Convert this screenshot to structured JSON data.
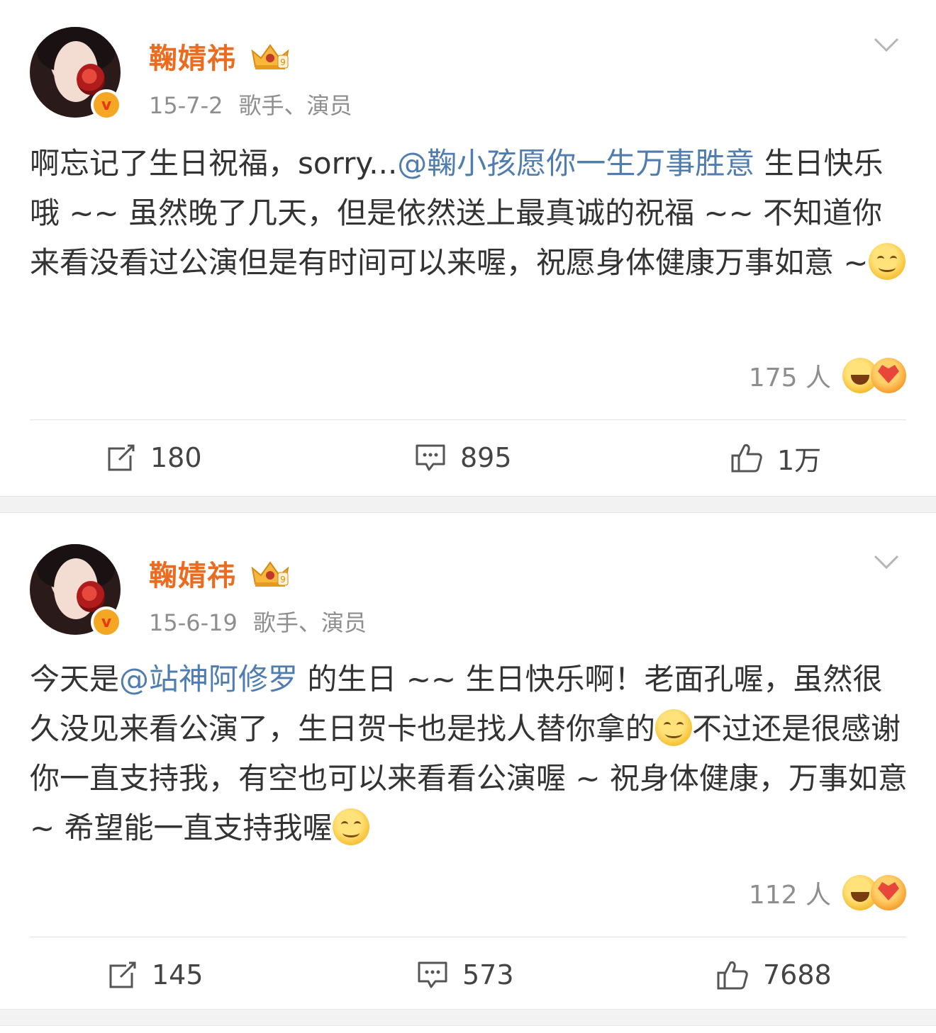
{
  "posts": [
    {
      "author": "鞠婧祎",
      "date": "15-7-2",
      "tags": "歌手、演员",
      "content_parts": [
        "啊忘记了生日祝福，sorry...",
        "@鞠小孩愿你一生万事胜意",
        " 生日快乐哦 ~~ 虽然晚了几天，但是依然送上最真诚的祝福 ~~ 不知道你来看没看过公演但是有时间可以来喔，祝愿身体健康万事如意 ~"
      ],
      "reaction_count": "175 人",
      "actions": {
        "repost": "180",
        "comment": "895",
        "like": "1万"
      }
    },
    {
      "author": "鞠婧祎",
      "date": "15-6-19",
      "tags": "歌手、演员",
      "content_parts": [
        "今天是",
        "@站神阿修罗",
        " 的生日 ~~ 生日快乐啊！老面孔喔，虽然很久没见来看公演了，生日贺卡也是找人替你拿的",
        "不过还是很感谢你一直支持我，有空也可以来看看公演喔 ~ 祝身体健康，万事如意 ~ 希望能一直支持我喔"
      ],
      "reaction_count": "112 人",
      "actions": {
        "repost": "145",
        "comment": "573",
        "like": "7688"
      }
    }
  ],
  "icons": {
    "verified": "verified-badge-icon",
    "vip": "vip-crown-icon",
    "menu": "chevron-down-icon",
    "repost": "repost-icon",
    "comment": "comment-icon",
    "like": "thumbs-up-icon"
  },
  "colors": {
    "name": "#eb6b1f",
    "mention": "#507daf",
    "meta": "#8e8e8e",
    "separator": "#f2f2f2"
  }
}
